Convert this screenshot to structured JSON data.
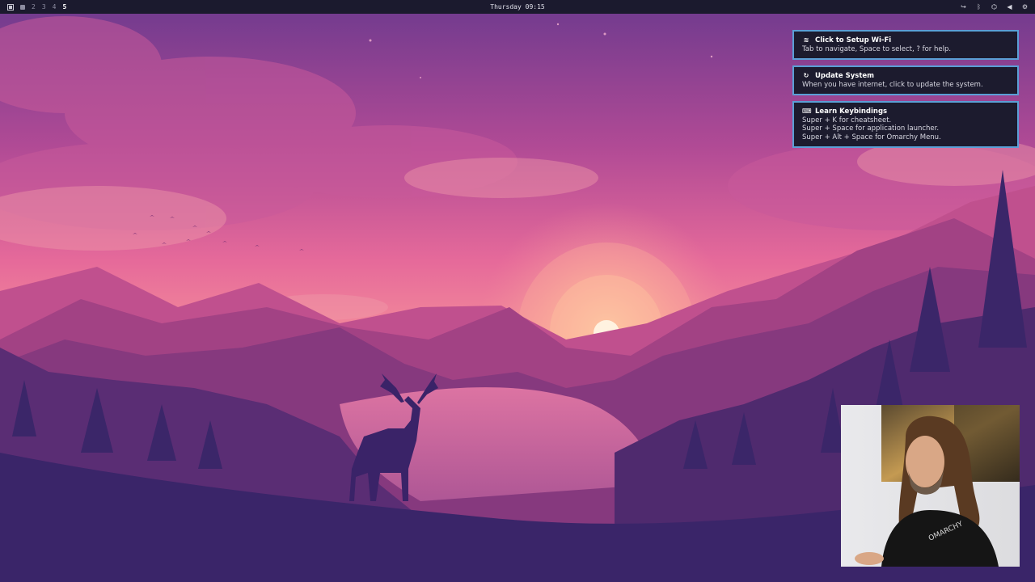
{
  "topbar": {
    "workspaces": [
      "2",
      "3",
      "4",
      "5"
    ],
    "clock": "Thursday 09:15",
    "tray_icons": [
      "logout-icon",
      "bluetooth-icon",
      "network-icon",
      "volume-icon",
      "settings-icon"
    ]
  },
  "notifications": [
    {
      "icon": "wifi-icon",
      "title": "Click to Setup Wi-Fi",
      "body": [
        "Tab to navigate, Space to select, ? for help."
      ]
    },
    {
      "icon": "refresh-icon",
      "title": "Update System",
      "body": [
        "When you have internet, click to update the system."
      ]
    },
    {
      "icon": "keyboard-icon",
      "title": "Learn Keybindings",
      "body": [
        "Super + K for cheatsheet.",
        "Super + Space for application launcher.",
        "Super + Alt + Space for Omarchy Menu."
      ]
    }
  ],
  "webcam": {
    "shirt_text": "OMARCHY"
  },
  "colors": {
    "notification_border": "#5a9fd6",
    "notification_bg": "#1c1b2e",
    "topbar_bg": "#1b1a2e"
  }
}
